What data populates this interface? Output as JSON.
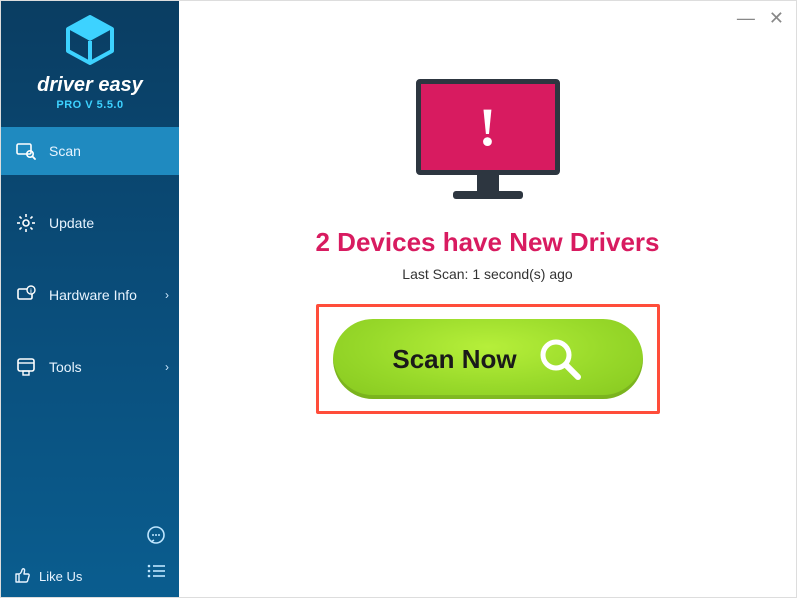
{
  "brand": {
    "name": "driver easy",
    "version": "PRO V 5.5.0"
  },
  "nav": {
    "scan": "Scan",
    "update": "Update",
    "hardware": "Hardware Info",
    "tools": "Tools"
  },
  "footer": {
    "like": "Like Us"
  },
  "main": {
    "headline": "2 Devices have New Drivers",
    "subline": "Last Scan: 1 second(s) ago",
    "scan_label": "Scan Now"
  }
}
